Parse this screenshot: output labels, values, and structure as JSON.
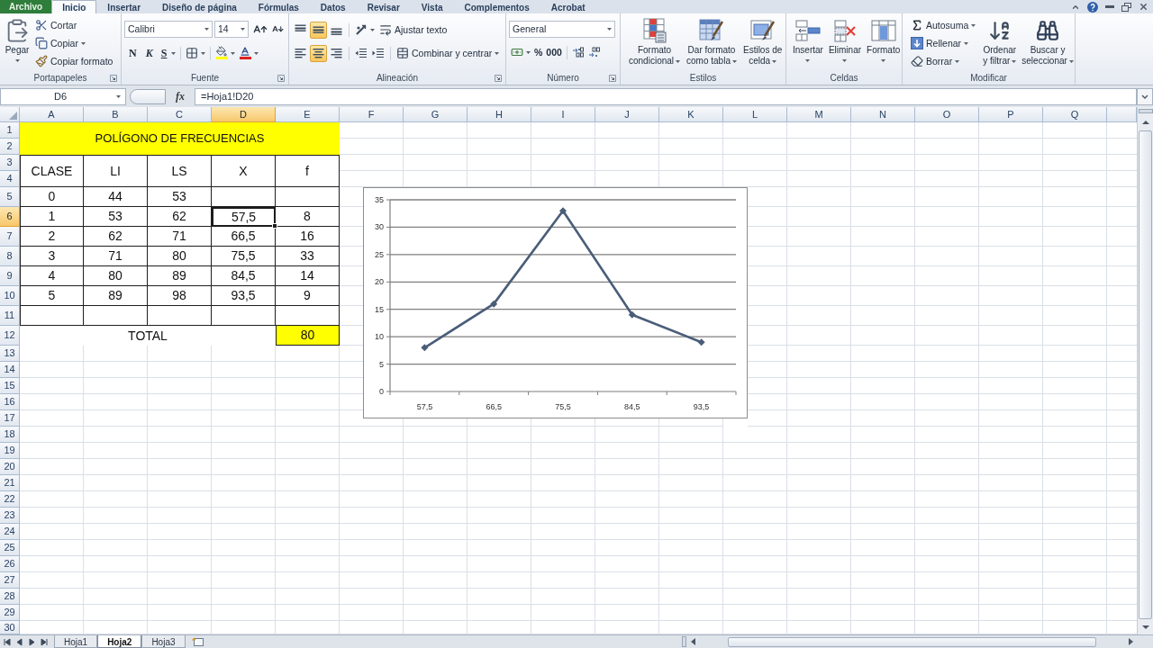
{
  "ribbon_tabs": [
    {
      "label": "Archivo",
      "kind": "file",
      "selected": false
    },
    {
      "label": "Inicio",
      "kind": "tab",
      "selected": true
    },
    {
      "label": "Insertar",
      "kind": "tab",
      "selected": false
    },
    {
      "label": "Diseño de página",
      "kind": "tab",
      "selected": false
    },
    {
      "label": "Fórmulas",
      "kind": "tab",
      "selected": false
    },
    {
      "label": "Datos",
      "kind": "tab",
      "selected": false
    },
    {
      "label": "Revisar",
      "kind": "tab",
      "selected": false
    },
    {
      "label": "Vista",
      "kind": "tab",
      "selected": false
    },
    {
      "label": "Complementos",
      "kind": "tab",
      "selected": false
    },
    {
      "label": "Acrobat",
      "kind": "tab",
      "selected": false
    }
  ],
  "clipboard": {
    "title": "Portapapeles",
    "paste": "Pegar",
    "cut": "Cortar",
    "copy": "Copiar",
    "format_painter": "Copiar formato"
  },
  "font": {
    "title": "Fuente",
    "name": "Calibri",
    "size": "14",
    "bold": "N",
    "italic": "K",
    "underline": "S"
  },
  "alignment": {
    "title": "Alineación",
    "vertical": [
      {
        "kind": "top",
        "selected": false
      },
      {
        "kind": "middle",
        "selected": true
      },
      {
        "kind": "bottom",
        "selected": false
      }
    ],
    "horizontal": [
      {
        "kind": "left",
        "selected": false
      },
      {
        "kind": "center",
        "selected": true
      },
      {
        "kind": "right",
        "selected": false
      }
    ],
    "wrap_text": "Ajustar texto",
    "merge_center": "Combinar y centrar"
  },
  "number": {
    "title": "Número",
    "format": "General",
    "percent": "%",
    "thousands": "000"
  },
  "styles": {
    "title": "Estilos",
    "buttons": [
      {
        "kind": "conditional",
        "lines": [
          "Formato",
          "condicional"
        ]
      },
      {
        "kind": "table",
        "lines": [
          "Dar formato",
          "como tabla"
        ]
      },
      {
        "kind": "cell",
        "lines": [
          "Estilos de",
          "celda"
        ]
      }
    ]
  },
  "cells": {
    "title": "Celdas",
    "buttons": [
      {
        "kind": "insert",
        "label": "Insertar"
      },
      {
        "kind": "delete",
        "label": "Eliminar"
      },
      {
        "kind": "format",
        "label": "Formato"
      }
    ]
  },
  "editing": {
    "title": "Modificar",
    "autosum": "Autosuma",
    "fill": "Rellenar",
    "clear": "Borrar",
    "sort": [
      "Ordenar",
      "y filtrar"
    ],
    "find": [
      "Buscar y",
      "seleccionar"
    ]
  },
  "formula_bar": {
    "name_box": "D6",
    "function_button": "fx",
    "formula": "=Hoja1!D20"
  },
  "sheet": {
    "columns": [
      {
        "label": "A",
        "selected": false
      },
      {
        "label": "B",
        "selected": false
      },
      {
        "label": "C",
        "selected": false
      },
      {
        "label": "D",
        "selected": true
      },
      {
        "label": "E",
        "selected": false
      },
      {
        "label": "F",
        "selected": false
      },
      {
        "label": "G",
        "selected": false
      },
      {
        "label": "H",
        "selected": false
      },
      {
        "label": "I",
        "selected": false
      },
      {
        "label": "J",
        "selected": false
      },
      {
        "label": "K",
        "selected": false
      },
      {
        "label": "L",
        "selected": false
      },
      {
        "label": "M",
        "selected": false
      },
      {
        "label": "N",
        "selected": false
      },
      {
        "label": "O",
        "selected": false
      },
      {
        "label": "P",
        "selected": false
      },
      {
        "label": "Q",
        "selected": false
      }
    ],
    "rows": [
      {
        "label": "1",
        "selected": false
      },
      {
        "label": "2",
        "selected": false
      },
      {
        "label": "3",
        "selected": false
      },
      {
        "label": "4",
        "selected": false
      },
      {
        "label": "5",
        "selected": false
      },
      {
        "label": "6",
        "selected": true
      },
      {
        "label": "7",
        "selected": false
      },
      {
        "label": "8",
        "selected": false
      },
      {
        "label": "9",
        "selected": false
      },
      {
        "label": "10",
        "selected": false
      },
      {
        "label": "11",
        "selected": false
      },
      {
        "label": "12",
        "selected": false
      },
      {
        "label": "13",
        "selected": false
      },
      {
        "label": "14",
        "selected": false
      },
      {
        "label": "15",
        "selected": false
      },
      {
        "label": "16",
        "selected": false
      },
      {
        "label": "17",
        "selected": false
      },
      {
        "label": "18",
        "selected": false
      },
      {
        "label": "19",
        "selected": false
      },
      {
        "label": "20",
        "selected": false
      },
      {
        "label": "21",
        "selected": false
      },
      {
        "label": "22",
        "selected": false
      },
      {
        "label": "23",
        "selected": false
      },
      {
        "label": "24",
        "selected": false
      },
      {
        "label": "25",
        "selected": false
      },
      {
        "label": "26",
        "selected": false
      },
      {
        "label": "27",
        "selected": false
      },
      {
        "label": "28",
        "selected": false
      },
      {
        "label": "29",
        "selected": false
      },
      {
        "label": "30",
        "selected": false
      }
    ]
  },
  "table": {
    "title": "POLÍGONO DE FRECUENCIAS",
    "headers": [
      "CLASE",
      "LI",
      "LS",
      "X",
      "f"
    ],
    "rows": [
      {
        "cells": [
          {
            "text": "0",
            "selected": false
          },
          {
            "text": "44",
            "selected": false
          },
          {
            "text": "53",
            "selected": false
          },
          {
            "selected": false
          },
          {
            "selected": false
          }
        ]
      },
      {
        "cells": [
          {
            "text": "1",
            "selected": false
          },
          {
            "text": "53",
            "selected": false
          },
          {
            "text": "62",
            "selected": false
          },
          {
            "text": "57,5",
            "selected": true
          },
          {
            "text": "8",
            "selected": false
          }
        ]
      },
      {
        "cells": [
          {
            "text": "2",
            "selected": false
          },
          {
            "text": "62",
            "selected": false
          },
          {
            "text": "71",
            "selected": false
          },
          {
            "text": "66,5",
            "selected": false
          },
          {
            "text": "16",
            "selected": false
          }
        ]
      },
      {
        "cells": [
          {
            "text": "3",
            "selected": false
          },
          {
            "text": "71",
            "selected": false
          },
          {
            "text": "80",
            "selected": false
          },
          {
            "text": "75,5",
            "selected": false
          },
          {
            "text": "33",
            "selected": false
          }
        ]
      },
      {
        "cells": [
          {
            "text": "4",
            "selected": false
          },
          {
            "text": "80",
            "selected": false
          },
          {
            "text": "89",
            "selected": false
          },
          {
            "text": "84,5",
            "selected": false
          },
          {
            "text": "14",
            "selected": false
          }
        ]
      },
      {
        "cells": [
          {
            "text": "5",
            "selected": false
          },
          {
            "text": "89",
            "selected": false
          },
          {
            "text": "98",
            "selected": false
          },
          {
            "text": "93,5",
            "selected": false
          },
          {
            "text": "9",
            "selected": false
          }
        ]
      }
    ],
    "total": {
      "label": "TOTAL",
      "value": "80"
    }
  },
  "chart": {
    "chart_data": {
      "type": "line",
      "categories": [
        "57,5",
        "66,5",
        "75,5",
        "84,5",
        "93,5"
      ],
      "series": [
        {
          "color": "#4a5d78",
          "marker": "diamond",
          "values": [
            8,
            16,
            33,
            14,
            9
          ]
        }
      ],
      "ylim": [
        0,
        35
      ],
      "yticks": [
        0,
        5,
        10,
        15,
        20,
        25,
        30,
        35
      ],
      "grid": true
    }
  },
  "sheet_tabs": [
    {
      "label": "Hoja1",
      "selected": false
    },
    {
      "label": "Hoja2",
      "selected": true
    },
    {
      "label": "Hoja3",
      "selected": false
    }
  ]
}
